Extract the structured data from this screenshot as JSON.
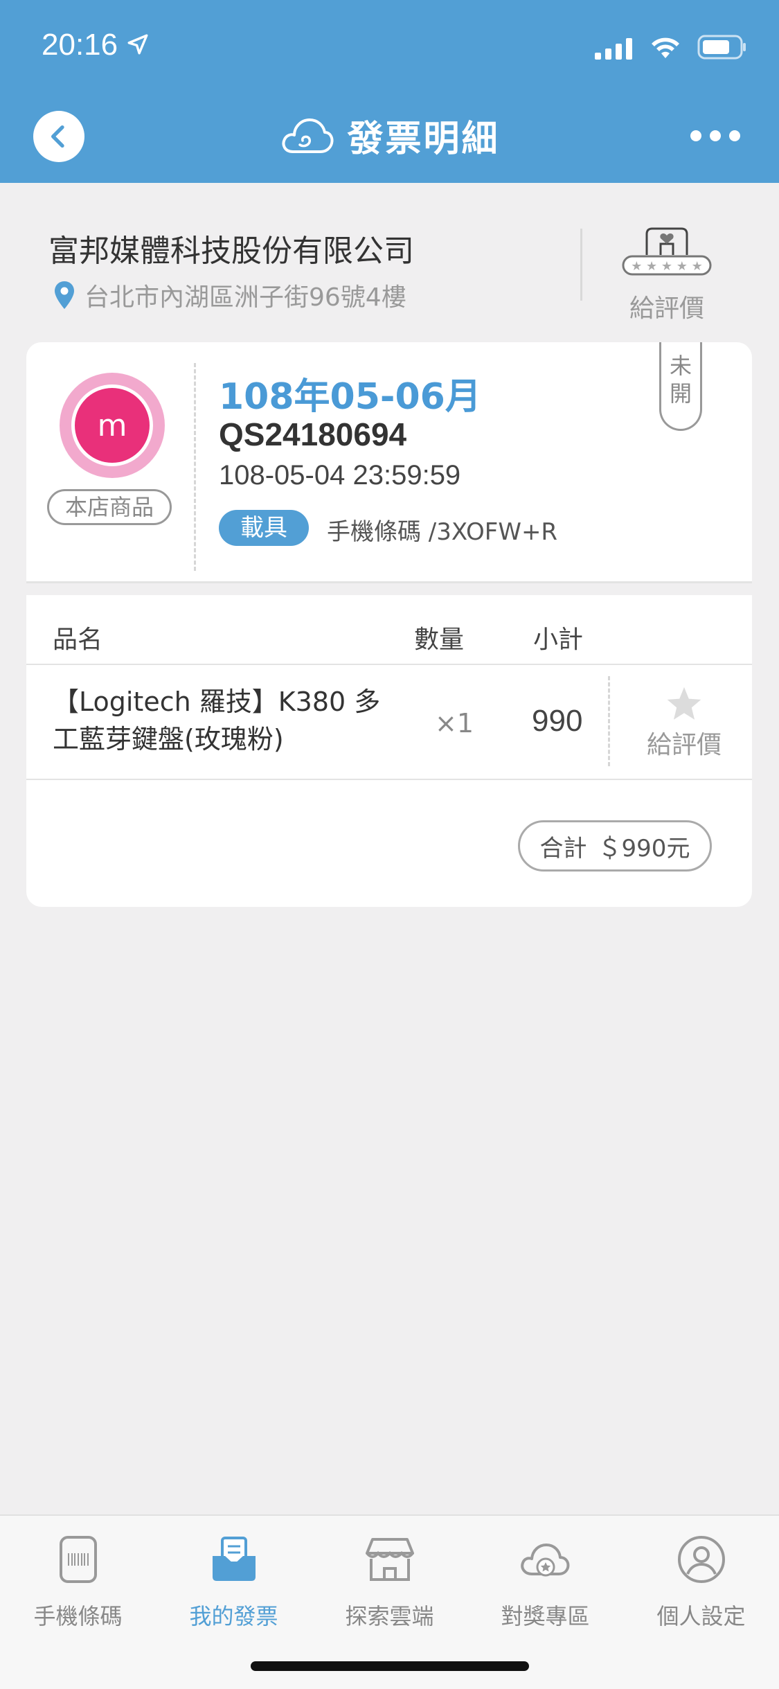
{
  "status_bar": {
    "time": "20:16"
  },
  "header": {
    "title": "發票明細"
  },
  "store": {
    "name": "富邦媒體科技股份有限公司",
    "address": "台北市內湖區洲子街96號4樓",
    "rate_label": "給評價"
  },
  "invoice": {
    "avatar_letter": "m",
    "store_tag": "本店商品",
    "period": "108年05-06月",
    "number": "QS24180694",
    "datetime": "108-05-04 23:59:59",
    "carrier_label": "載具",
    "carrier_value": "手機條碼 /3XOFW+R",
    "status_line1": "未",
    "status_line2": "開"
  },
  "table": {
    "headers": {
      "name": "品名",
      "qty": "數量",
      "subtotal": "小計"
    },
    "items": [
      {
        "name_line1": "【Logitech 羅技】K380 多",
        "name_line2": "工藍芽鍵盤(玫瑰粉)",
        "qty": "×1",
        "subtotal": "990",
        "rate_label": "給評價"
      }
    ],
    "total_label": "合計",
    "total_value": "＄990元"
  },
  "tabbar": {
    "items": [
      {
        "label": "手機條碼",
        "icon": "phone-barcode-icon",
        "active": false
      },
      {
        "label": "我的發票",
        "icon": "invoice-inbox-icon",
        "active": true
      },
      {
        "label": "探索雲端",
        "icon": "store-icon",
        "active": false
      },
      {
        "label": "對獎專區",
        "icon": "cloud-star-icon",
        "active": false
      },
      {
        "label": "個人設定",
        "icon": "user-icon",
        "active": false
      }
    ]
  },
  "colors": {
    "primary": "#529fd5",
    "avatar": "#e9307a",
    "avatar_ring": "#f2a9cd",
    "background": "#f0eff0"
  }
}
